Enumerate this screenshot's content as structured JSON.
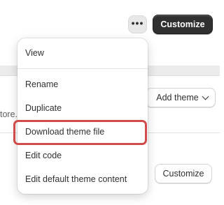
{
  "header": {
    "more_label": "•••",
    "customize_label": "Customize"
  },
  "theme_library": {
    "add_theme_label": "Add theme",
    "store_fragment": "tore.",
    "customize_label": "Customize"
  },
  "menu": {
    "items": [
      {
        "label": "View"
      },
      {
        "label": "Rename"
      },
      {
        "label": "Duplicate"
      },
      {
        "label": "Download theme file",
        "highlighted": true
      },
      {
        "label": "Edit code"
      },
      {
        "label": "Edit default theme content"
      }
    ],
    "highlight_color": "#d14b4b"
  },
  "colors": {
    "primary_button": "#303030",
    "band_gray": "#ebebeb"
  }
}
